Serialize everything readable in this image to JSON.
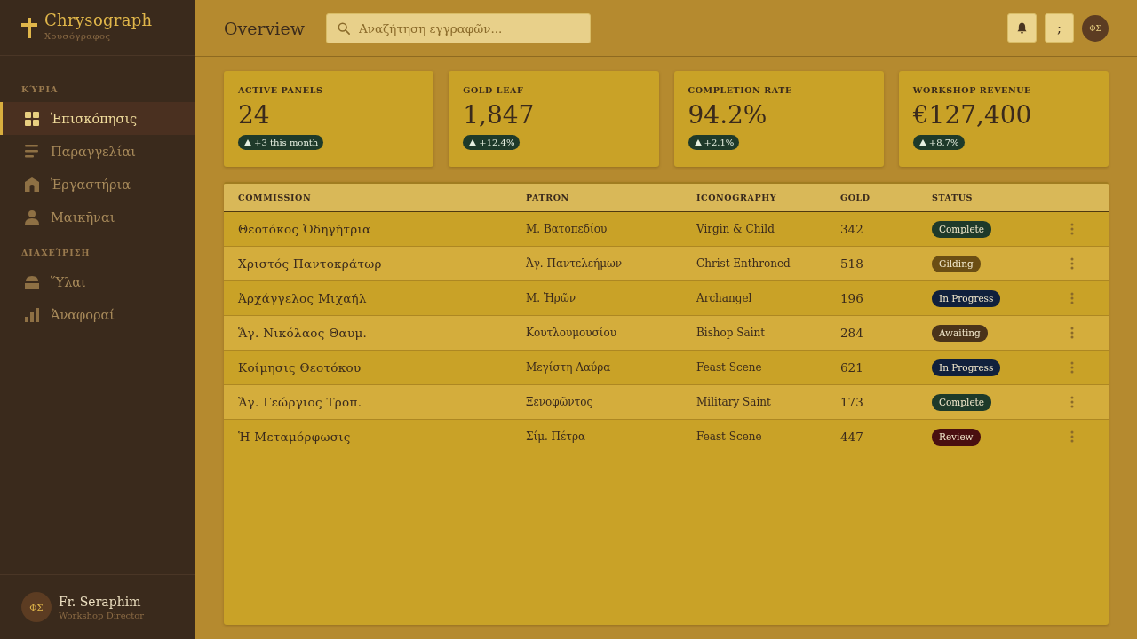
{
  "brand": {
    "name": "Chrysograph",
    "subtitle": "Χρυσόγραφος"
  },
  "sidebar": {
    "sections": [
      {
        "heading": "ΚΎΡΙΑ",
        "items": [
          {
            "label": "Ἐπισκόπησις",
            "selected": true
          },
          {
            "label": "Παραγγελίαι",
            "selected": false
          },
          {
            "label": "Ἐργαστήρια",
            "selected": false
          },
          {
            "label": "Μαικῆναι",
            "selected": false
          }
        ]
      },
      {
        "heading": "ΔΙΑΧΕΊΡΙΣΗ",
        "items": [
          {
            "label": "Ὕλαι",
            "selected": false
          },
          {
            "label": "Ἀναφοραί",
            "selected": false
          }
        ]
      }
    ]
  },
  "user": {
    "initials": "ΦΣ",
    "name": "Fr. Seraphim",
    "role": "Workshop Director"
  },
  "header": {
    "title": "Overview",
    "search": {
      "placeholder": "Αναζήτηση εγγραφῶν..."
    },
    "menu_button": ";",
    "avatar_initials": "ΦΣ"
  },
  "stats": [
    {
      "label": "ACTIVE PANELS",
      "value": "24",
      "delta": "+3 this month"
    },
    {
      "label": "GOLD LEAF",
      "value": "1,847",
      "delta": "+12.4%"
    },
    {
      "label": "COMPLETION RATE",
      "value": "94.2%",
      "delta": "+2.1%"
    },
    {
      "label": "WORKSHOP REVENUE",
      "value": "€127,400",
      "delta": "+8.7%"
    }
  ],
  "table": {
    "columns": [
      "COMMISSION",
      "PATRON",
      "ICONOGRAPHY",
      "GOLD",
      "STATUS"
    ],
    "rows": [
      {
        "commission": "Θεοτόκος Ὁδηγήτρια",
        "patron": "Μ. Βατοπεδίου",
        "iconography": "Virgin & Child",
        "gold": "342",
        "status": {
          "label": "Complete",
          "color": "#1e3a2a"
        }
      },
      {
        "commission": "Χριστός Παντοκράτωρ",
        "patron": "Ἁγ. Παντελεήμων",
        "iconography": "Christ Enthroned",
        "gold": "518",
        "status": {
          "label": "Gilding",
          "color": "#6b4e14"
        }
      },
      {
        "commission": "Ἀρχάγγελος Μιχαήλ",
        "patron": "Μ. Ἡρῶν",
        "iconography": "Archangel",
        "gold": "196",
        "status": {
          "label": "In Progress",
          "color": "#10203c"
        }
      },
      {
        "commission": "Ἅγ. Νικόλαος Θαυμ.",
        "patron": "Κουτλουμουσίου",
        "iconography": "Bishop Saint",
        "gold": "284",
        "status": {
          "label": "Awaiting",
          "color": "#4a331a"
        }
      },
      {
        "commission": "Κοίμησις Θεοτόκου",
        "patron": "Μεγίστη Λαύρα",
        "iconography": "Feast Scene",
        "gold": "621",
        "status": {
          "label": "In Progress",
          "color": "#10203c"
        }
      },
      {
        "commission": "Ἅγ. Γεώργιος Τροπ.",
        "patron": "Ξενοφῶντος",
        "iconography": "Military Saint",
        "gold": "173",
        "status": {
          "label": "Complete",
          "color": "#1e3a2a"
        }
      },
      {
        "commission": "Ἡ Μεταμόρφωσις",
        "patron": "Σίμ. Πέτρα",
        "iconography": "Feast Scene",
        "gold": "447",
        "status": {
          "label": "Review",
          "color": "#4a1010"
        }
      }
    ]
  }
}
